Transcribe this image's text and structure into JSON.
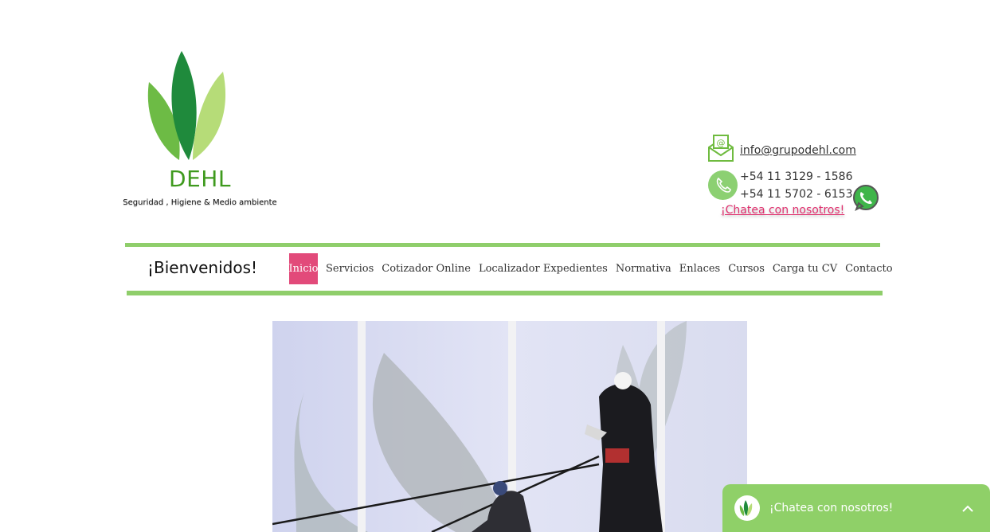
{
  "header": {
    "logo": {
      "name": "DEHL",
      "tagline": "Seguridad , Higiene & Medio ambiente",
      "leaf_colors": [
        "#1e8a3a",
        "#5bb54a",
        "#a8d86a"
      ]
    },
    "contact": {
      "email": "info@grupodehl.com",
      "phones": [
        "+54 11 3129 - 1586",
        "+54 11 5702 - 6153"
      ],
      "chat_link": "¡Chatea con nosotros!",
      "email_icon": "envelope-at-icon",
      "phone_icon": "phone-icon",
      "whatsapp_icon": "whatsapp-icon"
    }
  },
  "nav": {
    "welcome": "¡Bienvenidos!",
    "items": [
      {
        "label": "Inicio",
        "active": true
      },
      {
        "label": "Servicios",
        "active": false
      },
      {
        "label": "Cotizador Online",
        "active": false
      },
      {
        "label": "Localizador Expedientes",
        "active": false
      },
      {
        "label": "Normativa",
        "active": false
      },
      {
        "label": "Enlaces",
        "active": false
      },
      {
        "label": "Cursos",
        "active": false
      },
      {
        "label": "Carga tu CV",
        "active": false
      },
      {
        "label": "Contacto",
        "active": false
      }
    ],
    "accent_color": "#8fce6b",
    "active_color": "#e24a7a"
  },
  "hero": {
    "description_icon": "rope-access-workers-image"
  },
  "chat_widget": {
    "label": "¡Chatea con nosotros!",
    "background": "#8fd068"
  }
}
